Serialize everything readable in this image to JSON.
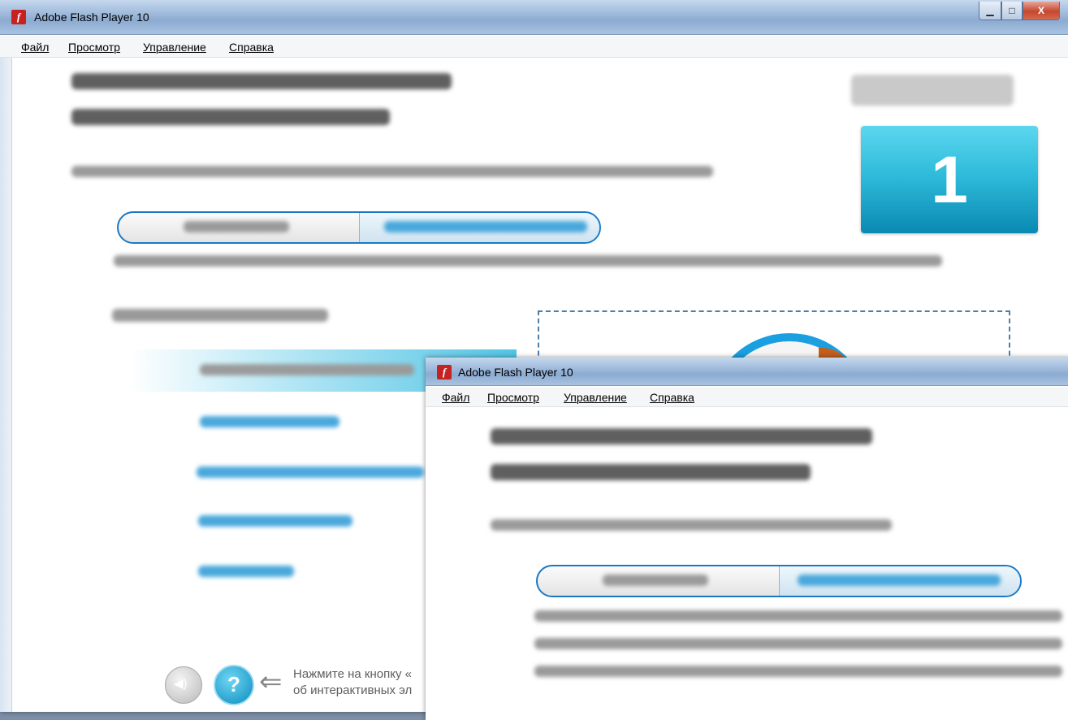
{
  "window": {
    "title": "Adobe Flash Player 10"
  },
  "menu": [
    "Файл",
    "Просмотр",
    "Управление",
    "Справка"
  ],
  "badge": {
    "number": "1"
  },
  "hint": {
    "line1": "Нажмите на кнопку «",
    "line2": "об интерактивных эл"
  },
  "colors": {
    "accent": "#1b79c4",
    "badge": "#1fb1d6",
    "titlebar": "#9fbadb",
    "close": "#c5472f"
  },
  "icons": [
    "flash-icon",
    "minimize-icon",
    "maximize-icon",
    "close-icon",
    "sound-icon",
    "help-icon",
    "back-arrow-icon"
  ],
  "second_window": {
    "title": "Adobe Flash Player 10"
  }
}
